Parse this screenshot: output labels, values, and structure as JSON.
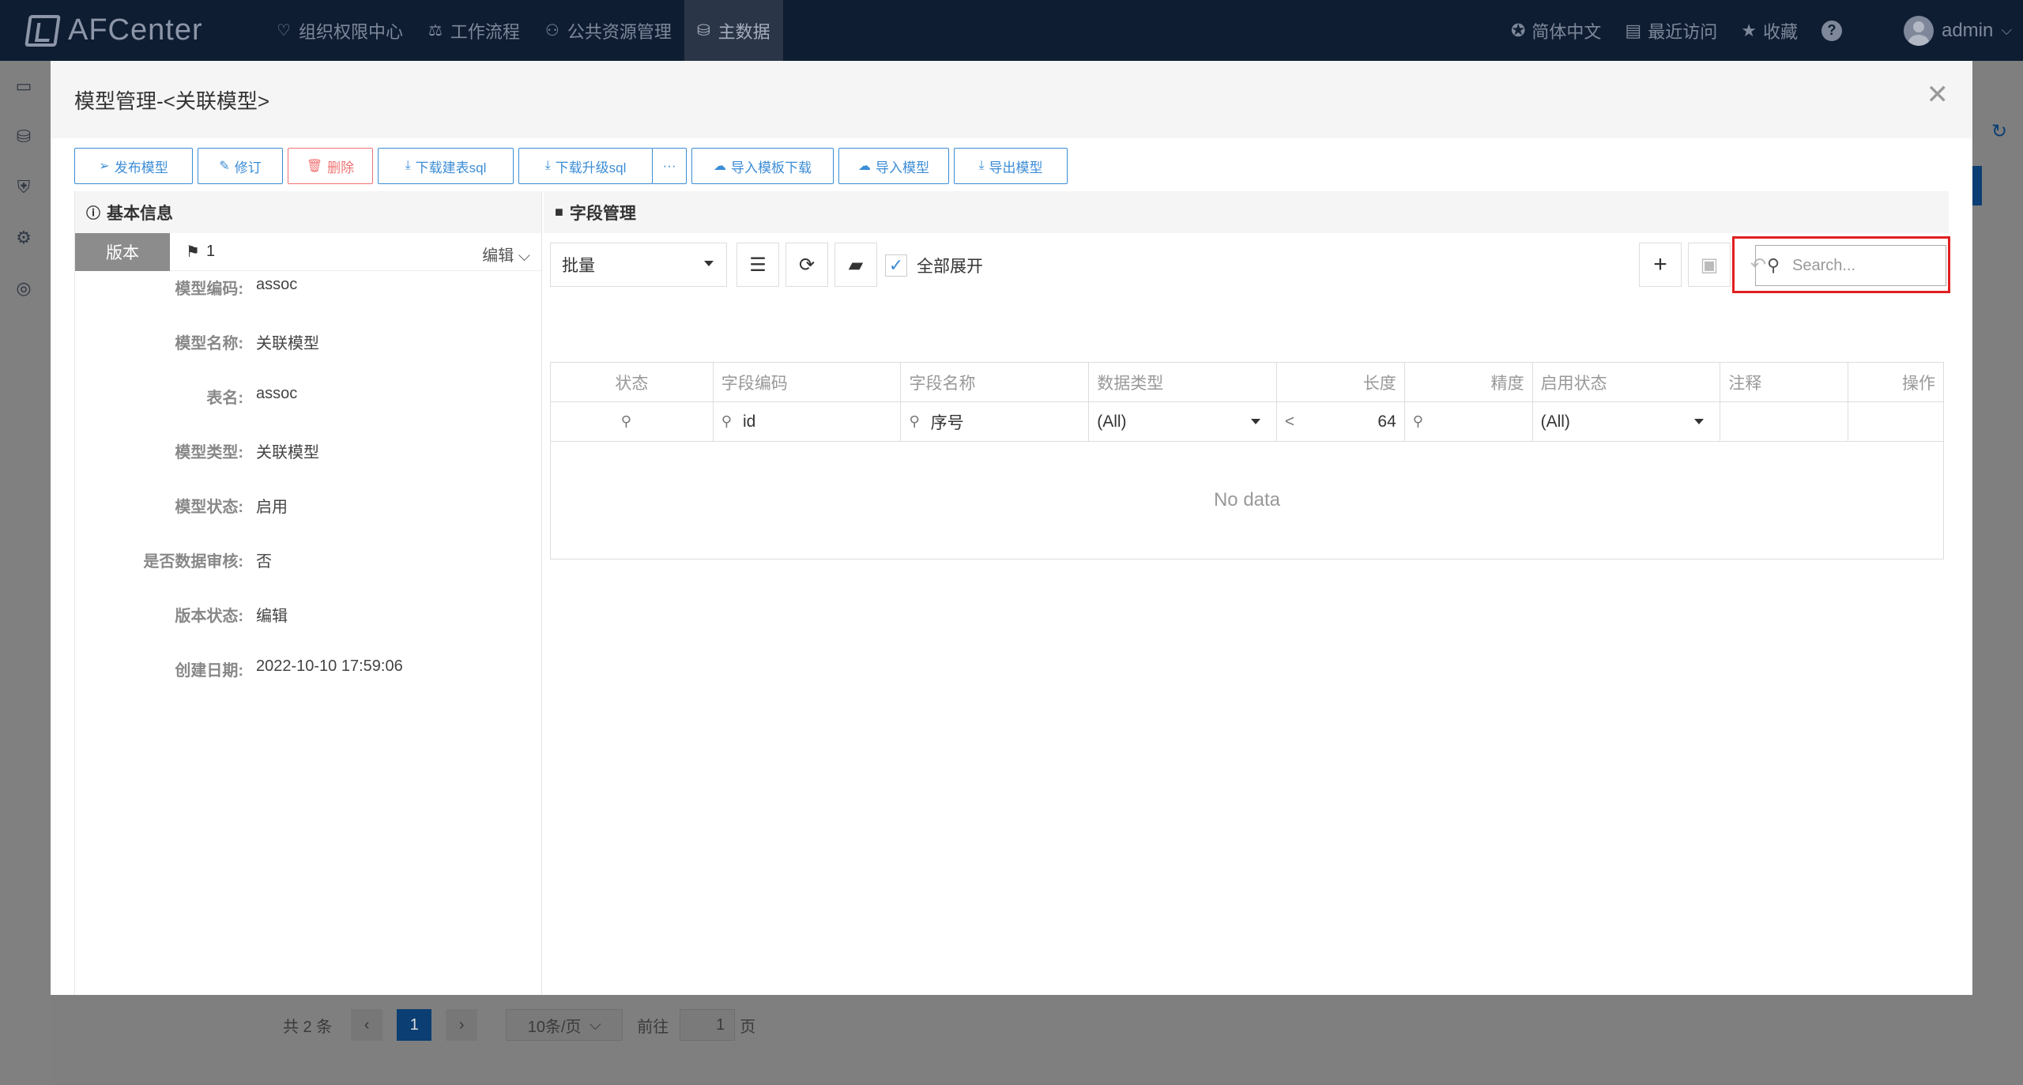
{
  "app": {
    "logo": "AFCenter"
  },
  "nav": [
    {
      "label": "组织权限中心",
      "icon": "shield-heart-icon"
    },
    {
      "label": "工作流程",
      "icon": "scale-icon"
    },
    {
      "label": "公共资源管理",
      "icon": "people-icon"
    },
    {
      "label": "主数据",
      "icon": "database-icon",
      "active": true
    }
  ],
  "top_right": {
    "language": "简体中文",
    "recent": "最近访问",
    "favorites": "收藏",
    "user": "admin"
  },
  "background_page": {
    "total": "共 2 条",
    "current_page": "1",
    "page_size": "10条/页",
    "goto_label": "前往",
    "goto_value": "1",
    "page_unit": "页"
  },
  "modal": {
    "title": "模型管理-<关联模型>",
    "toolbar": {
      "publish": "发布模型",
      "revise": "修订",
      "delete": "删除",
      "download_create_sql": "下载建表sql",
      "download_upgrade_sql": "下载升级sql",
      "more": "···",
      "import_template_download": "导入模板下载",
      "import_model": "导入模型",
      "export_model": "导出模型"
    },
    "basic_info": {
      "heading": "基本信息",
      "version_tag": "版本",
      "version_number": "1",
      "edit_label": "编辑",
      "fields": [
        {
          "label": "模型编码:",
          "value": "assoc"
        },
        {
          "label": "模型名称:",
          "value": "关联模型"
        },
        {
          "label": "表名:",
          "value": "assoc"
        },
        {
          "label": "模型类型:",
          "value": "关联模型"
        },
        {
          "label": "模型状态:",
          "value": "启用"
        },
        {
          "label": "是否数据审核:",
          "value": "否"
        },
        {
          "label": "版本状态:",
          "value": "编辑"
        },
        {
          "label": "创建日期:",
          "value": "2022-10-10 17:59:06"
        }
      ]
    },
    "field_mgmt": {
      "heading": "字段管理",
      "batch_select": "批量",
      "expand_all": "全部展开",
      "search_placeholder": "Search...",
      "columns": [
        "状态",
        "字段编码",
        "字段名称",
        "数据类型",
        "长度",
        "精度",
        "启用状态",
        "注释",
        "操作"
      ],
      "filters": {
        "code": "id",
        "name": "序号",
        "data_type": "(All)",
        "length_op": "<",
        "length_value": "64",
        "enable_status": "(All)"
      },
      "empty_text": "No data"
    }
  }
}
